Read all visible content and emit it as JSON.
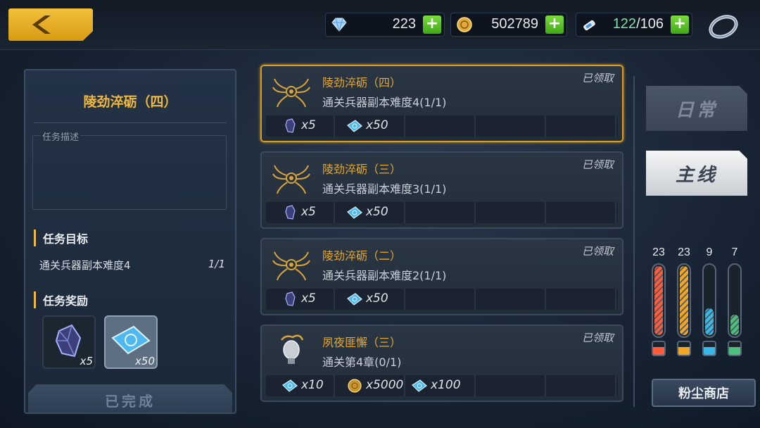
{
  "topbar": {
    "back_icon": "chevron-left-icon",
    "gems": {
      "icon": "diamond-icon",
      "value": "223"
    },
    "coins": {
      "icon": "coin-icon",
      "value": "502789"
    },
    "stamina": {
      "icon": "syringe-icon",
      "current": "122",
      "separator": "/",
      "max": "106",
      "current_color": "#7fe0a8"
    },
    "settings_icon": "ring-icon"
  },
  "detail": {
    "title": "陵劲淬砺（四）",
    "desc_label": "任务描述",
    "goal_heading": "任务目标",
    "goal_text": "通关兵器副本难度4",
    "goal_progress": "1/1",
    "reward_heading": "任务奖励",
    "rewards": [
      {
        "icon": "crystal-icon",
        "qty": "x5"
      },
      {
        "icon": "blueprint-icon",
        "qty": "x50"
      }
    ],
    "done_label": "已完成"
  },
  "quests": [
    {
      "name": "陵劲淬砺（四）",
      "desc": "通关兵器副本难度4(1/1)",
      "status": "已领取",
      "emblem": "winged-emblem-icon",
      "rewards": [
        {
          "icon": "crystal-icon",
          "qty": "x5"
        },
        {
          "icon": "blueprint-icon",
          "qty": "x50"
        }
      ]
    },
    {
      "name": "陵劲淬砺（三）",
      "desc": "通关兵器副本难度3(1/1)",
      "status": "已领取",
      "emblem": "winged-emblem-icon",
      "rewards": [
        {
          "icon": "crystal-icon",
          "qty": "x5"
        },
        {
          "icon": "blueprint-icon",
          "qty": "x50"
        }
      ]
    },
    {
      "name": "陵劲淬砺（二）",
      "desc": "通关兵器副本难度2(1/1)",
      "status": "已领取",
      "emblem": "winged-emblem-icon",
      "rewards": [
        {
          "icon": "crystal-icon",
          "qty": "x5"
        },
        {
          "icon": "blueprint-icon",
          "qty": "x50"
        }
      ]
    },
    {
      "name": "夙夜匪懈（三）",
      "desc": "通关第4章(0/1)",
      "status": "已领取",
      "emblem": "lightbulb-icon",
      "rewards": [
        {
          "icon": "blueprint-icon",
          "qty": "x10"
        },
        {
          "icon": "coin-icon",
          "qty": "x5000"
        },
        {
          "icon": "blueprint-icon",
          "qty": "x100"
        }
      ]
    }
  ],
  "tabs": {
    "daily": "日常",
    "main": "主线"
  },
  "meters": [
    {
      "value": "23",
      "level": 1.0,
      "color": "#ff5a3c"
    },
    {
      "value": "23",
      "level": 1.0,
      "color": "#f2a623"
    },
    {
      "value": "9",
      "level": 0.39,
      "color": "#38b8e8"
    },
    {
      "value": "7",
      "level": 0.3,
      "color": "#4cc07a"
    }
  ],
  "shop_label": "粉尘商店"
}
